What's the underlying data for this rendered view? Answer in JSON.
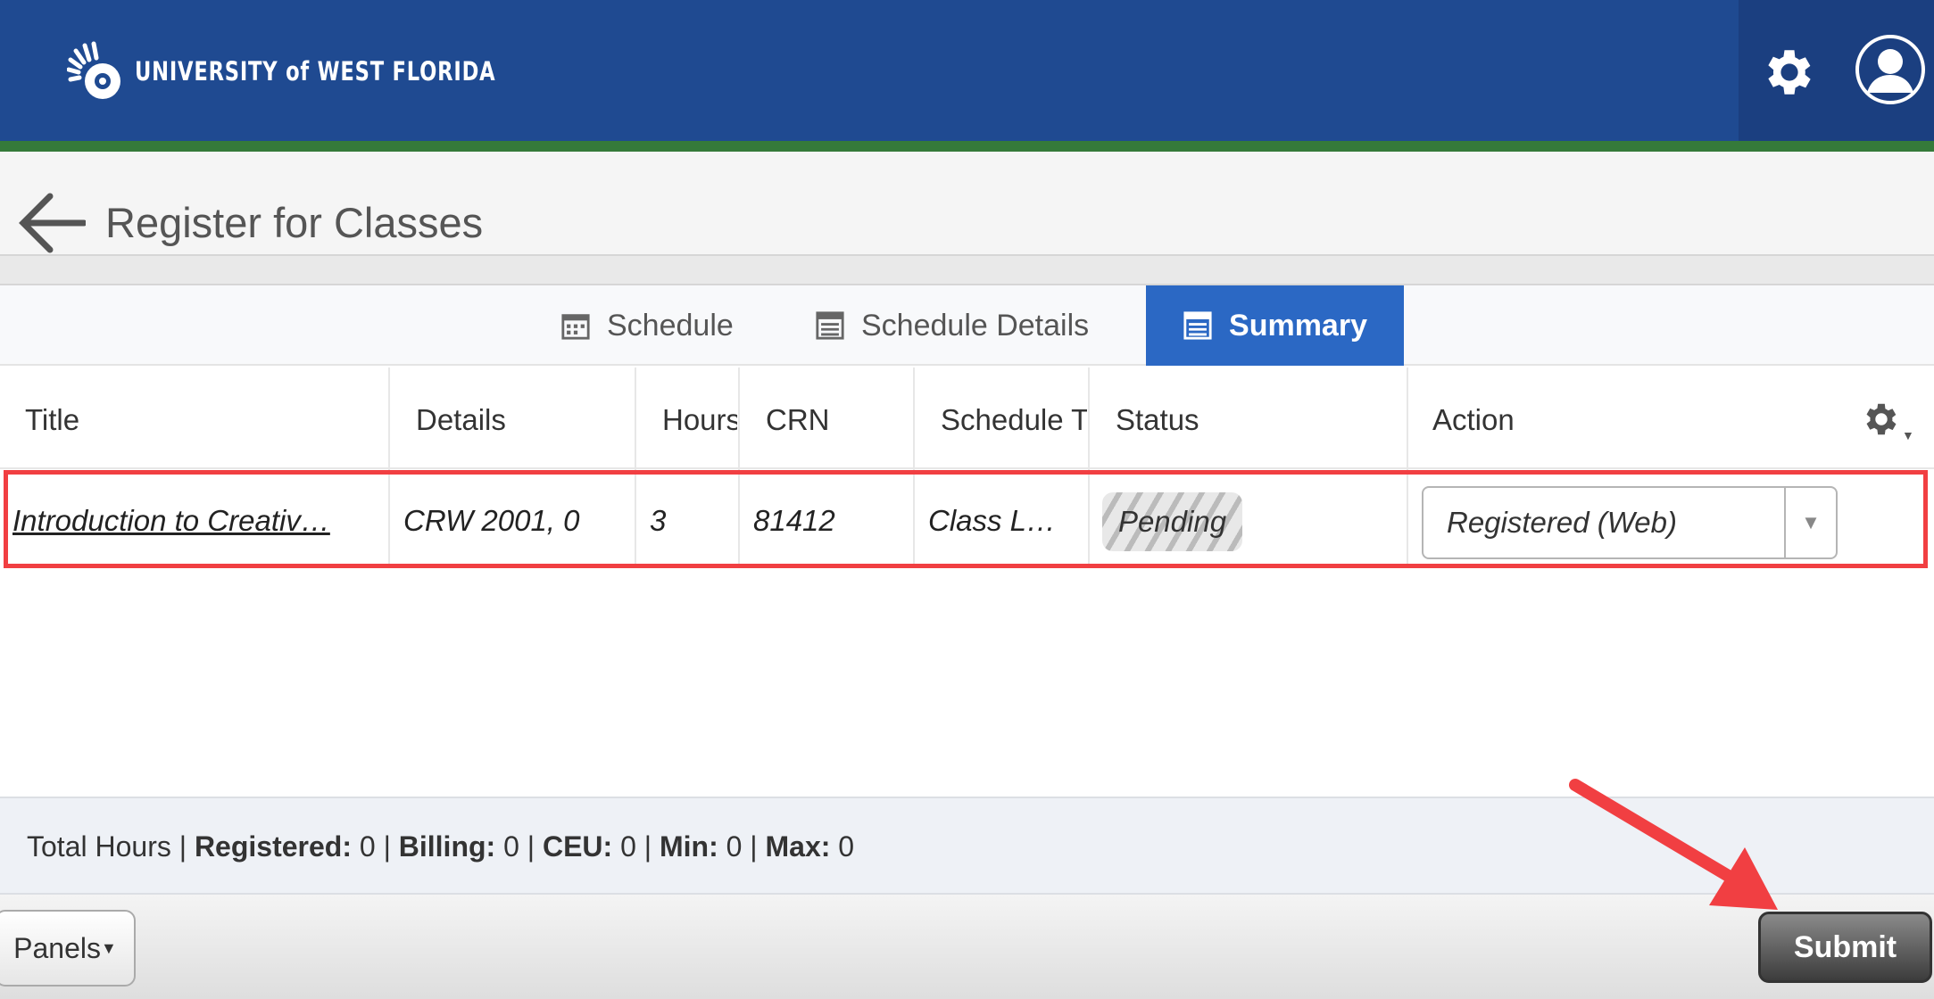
{
  "header": {
    "logo_text": "UNIVERSITY of WEST FLORIDA",
    "logo_parts": [
      "UNIVERSITY",
      "of",
      "WEST",
      "FLORIDA"
    ],
    "brand_color": "#1f4a91",
    "accent_color": "#357a3a"
  },
  "page": {
    "title": "Register for Classes"
  },
  "tabs": [
    {
      "label": "Schedule",
      "icon": "calendar-icon",
      "active": false
    },
    {
      "label": "Schedule Details",
      "icon": "table-icon",
      "active": false
    },
    {
      "label": "Summary",
      "icon": "table-icon",
      "active": true
    }
  ],
  "table": {
    "columns": [
      "Title",
      "Details",
      "Hours",
      "CRN",
      "Schedule Type",
      "Status",
      "Action"
    ],
    "rows": [
      {
        "title": "Introduction to Creativ…",
        "details": "CRW 2001, 0",
        "hours": "3",
        "crn": "81412",
        "schedule_type": "Class L…",
        "status": "Pending",
        "action": "Registered (Web)"
      }
    ]
  },
  "totals": {
    "label": "Total Hours",
    "registered_label": "Registered:",
    "registered": "0",
    "billing_label": "Billing:",
    "billing": "0",
    "ceu_label": "CEU:",
    "ceu": "0",
    "min_label": "Min:",
    "min": "0",
    "max_label": "Max:",
    "max": "0"
  },
  "footer": {
    "panels_label": "Panels",
    "submit_label": "Submit"
  },
  "annotation_color": "#f13f42"
}
